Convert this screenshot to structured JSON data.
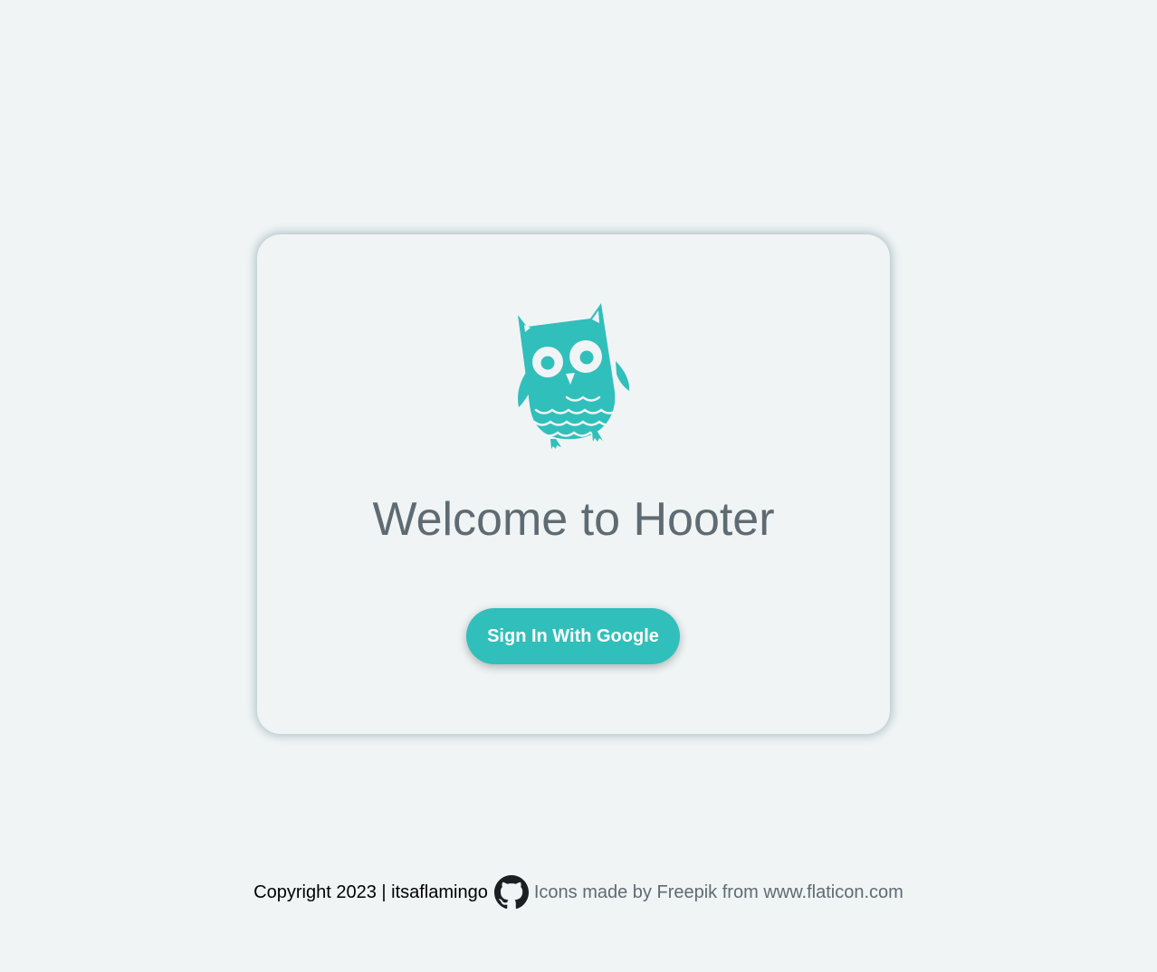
{
  "colors": {
    "background": "#f0f4f5",
    "accent": "#31bfbb",
    "text_muted": "#5f6b73"
  },
  "login_card": {
    "logo_icon": "owl-icon",
    "title": "Welcome to Hooter",
    "signin_label": "Sign In With Google"
  },
  "footer": {
    "copyright": "Copyright 2023 | itsaflamingo",
    "github_icon": "github-icon",
    "credits_prefix": "Icons made by",
    "credits_author": "Freepik",
    "credits_middle": "from",
    "credits_site": "www.flaticon.com"
  }
}
